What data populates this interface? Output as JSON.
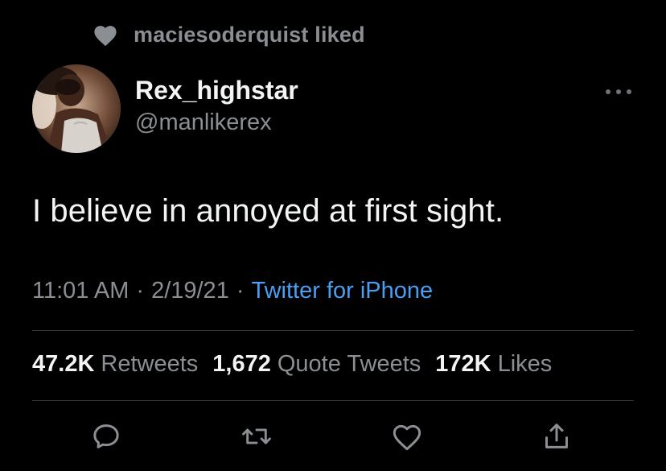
{
  "social_context": {
    "icon": "heart-icon",
    "text": "maciesoderquist liked"
  },
  "author": {
    "avatar": "avatar",
    "display_name": "Rex_highstar",
    "handle": "@manlikerex"
  },
  "more_icon": "more-horizontal-icon",
  "tweet": {
    "text": "I believe in annoyed at first sight.",
    "time": "11:01 AM",
    "date": "2/19/21",
    "separator": "·",
    "source": "Twitter for iPhone"
  },
  "stats": {
    "retweets": {
      "count": "47.2K",
      "label": "Retweets"
    },
    "quote_tweets": {
      "count": "1,672",
      "label": "Quote Tweets"
    },
    "likes": {
      "count": "172K",
      "label": "Likes"
    }
  },
  "actions": [
    {
      "icon": "reply-icon"
    },
    {
      "icon": "retweet-icon"
    },
    {
      "icon": "like-heart-icon"
    },
    {
      "icon": "share-icon"
    }
  ],
  "colors": {
    "background": "#000000",
    "text_primary": "#f3f4f5",
    "text_secondary": "#8b8f94",
    "link": "#4a9ef3",
    "divider": "#2f3336"
  }
}
